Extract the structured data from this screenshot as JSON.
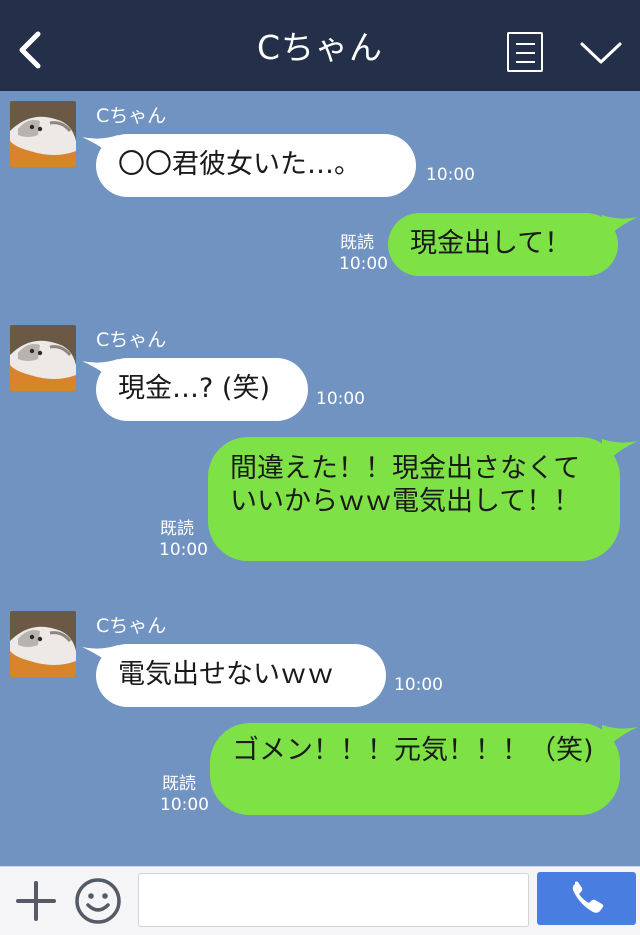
{
  "header": {
    "title": "Cちゃん"
  },
  "messages": [
    {
      "sender": "Cちゃん",
      "text": "〇〇君彼女いた…。",
      "time": "10:00"
    },
    {
      "text": "現金出して！",
      "read": "既読",
      "time": "10:00"
    },
    {
      "sender": "Cちゃん",
      "text": "現金…? (笑)",
      "time": "10:00"
    },
    {
      "text": "間違えた！！現金出さなくていいからｗｗ電気出して！！",
      "read": "既読",
      "time": "10:00"
    },
    {
      "sender": "Cちゃん",
      "text": "電気出せないｗｗ",
      "time": "10:00"
    },
    {
      "text": "ゴメン！！！元気！！！（笑)",
      "read": "既読",
      "time": "10:00"
    }
  ],
  "input": {
    "placeholder": ""
  },
  "colors": {
    "header": "#243049",
    "background": "#7193c2",
    "outgoing_bubble": "#7ee246",
    "incoming_bubble": "#ffffff",
    "call_button": "#4a7de0"
  },
  "icons": {
    "back": "chevron-left-icon",
    "menu": "list-icon",
    "collapse": "chevron-down-icon",
    "add": "plus-icon",
    "emoji": "smiley-icon",
    "call": "phone-icon"
  }
}
